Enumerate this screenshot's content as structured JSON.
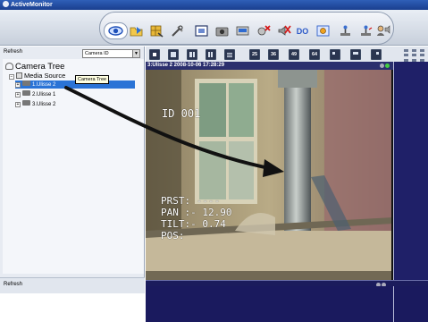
{
  "app": {
    "title": "ActiveMonitor"
  },
  "toolbar": {
    "buttons": [
      {
        "id": "live",
        "icon": "eye-icon"
      },
      {
        "id": "playback",
        "icon": "folder-icon"
      },
      {
        "id": "config",
        "icon": "grid-config-icon"
      },
      {
        "id": "tools",
        "icon": "wrench-icon"
      },
      {
        "id": "fullscreen",
        "icon": "window-icon"
      },
      {
        "id": "snapshot",
        "icon": "camera-icon"
      },
      {
        "id": "record",
        "icon": "recorder-icon"
      },
      {
        "id": "alarm-off",
        "icon": "alarm-off-icon"
      },
      {
        "id": "mute",
        "icon": "mute-icon"
      },
      {
        "id": "do",
        "icon": "do-icon",
        "label": "DO"
      },
      {
        "id": "settings",
        "icon": "settings-icon"
      },
      {
        "id": "ptz1",
        "icon": "joystick-icon"
      },
      {
        "id": "ptz2",
        "icon": "joystick-remote-icon"
      },
      {
        "id": "user",
        "icon": "user-speaker-icon"
      }
    ]
  },
  "left_panel": {
    "refresh_top": "Refresh",
    "camera_select": {
      "value": "Camera ID"
    },
    "tree_title": "Camera Tree",
    "media_source": "Media Source",
    "items": [
      "1.Ulisse 2",
      "2.Ulisse 1",
      "3.Ulisse 2"
    ],
    "tooltip": "Camera Tree",
    "refresh_bottom": "Refresh"
  },
  "layout_bar": {
    "buttons": [
      "",
      "",
      "",
      "",
      "",
      "25",
      "36",
      "49",
      "64",
      "",
      "",
      ""
    ]
  },
  "video": {
    "header": "3:Ulisse 2   2008-10-06 17:28:29",
    "osd": {
      "id": "ID 001",
      "prst_label": "PRST",
      "prst_value": "----",
      "pan_label": "PAN",
      "pan_value": "12.90",
      "tilt_label": "TILT",
      "tilt_value": "0.74",
      "pos_label": "POS"
    }
  },
  "colors": {
    "title_bar": "#1a3f8f",
    "selected_item": "#2a73d6",
    "video_header": "#2b2f6e",
    "right_panel": "#1f2068",
    "arrow": "#111111"
  }
}
